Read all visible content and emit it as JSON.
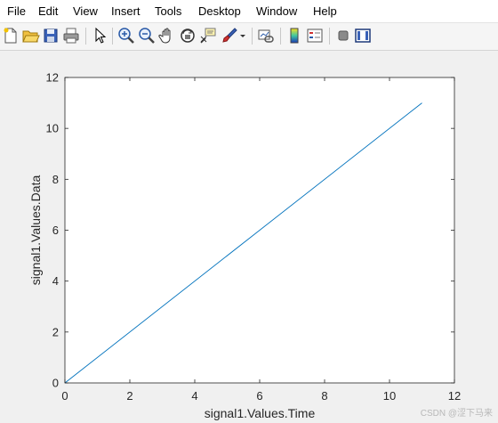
{
  "menu": {
    "file": "File",
    "edit": "Edit",
    "view": "View",
    "insert": "Insert",
    "tools": "Tools",
    "desktop": "Desktop",
    "window": "Window",
    "help": "Help"
  },
  "toolbar": {
    "icons": [
      "new-file-icon",
      "open-folder-icon",
      "save-icon",
      "print-icon",
      "pointer-icon",
      "zoom-in-icon",
      "zoom-out-icon",
      "pan-hand-icon",
      "rotate-3d-icon",
      "data-cursor-icon",
      "brush-icon",
      "link-plot-icon",
      "colorbar-icon",
      "legend-icon",
      "hide-plot-tools-icon",
      "show-plot-tools-icon"
    ]
  },
  "colors": {
    "line": "#0072bd",
    "axes": "#262626",
    "plot_bg": "#ffffff",
    "figure_bg": "#f0f0f0"
  },
  "chart_data": {
    "type": "line",
    "title": "",
    "xlabel": "signal1.Values.Time",
    "ylabel": "signal1.Values.Data",
    "xlim": [
      0,
      12
    ],
    "ylim": [
      0,
      12
    ],
    "x_ticks": [
      "0",
      "2",
      "4",
      "6",
      "8",
      "10",
      "12"
    ],
    "y_ticks": [
      "0",
      "2",
      "4",
      "6",
      "8",
      "10",
      "12"
    ],
    "grid": false,
    "series": [
      {
        "x": [
          0,
          11
        ],
        "y": [
          0,
          11
        ],
        "color": "#0072bd"
      }
    ]
  },
  "watermark": "CSDN @涩下马来"
}
